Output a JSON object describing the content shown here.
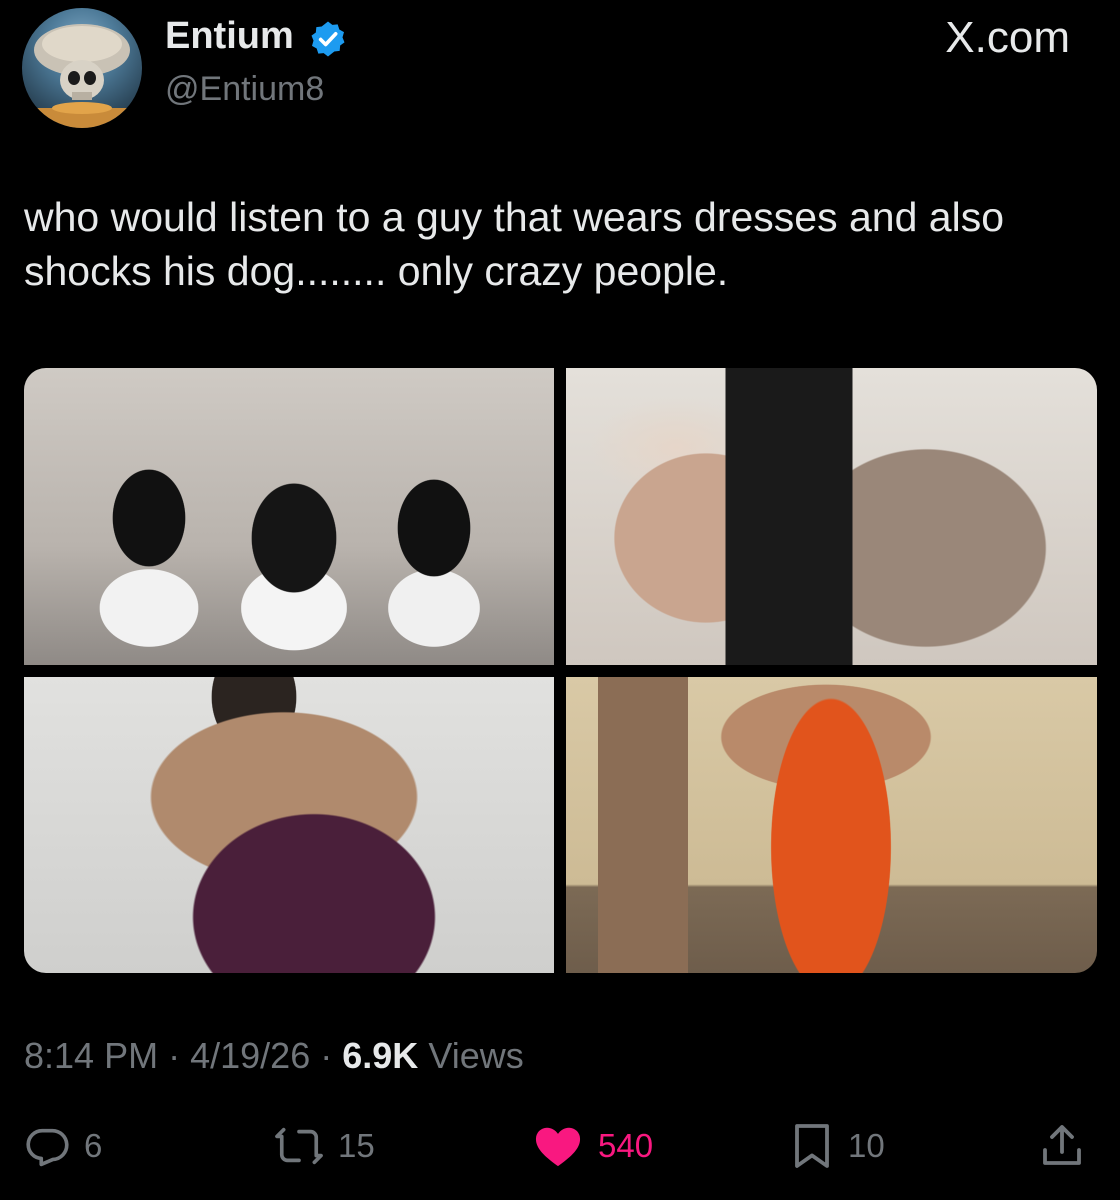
{
  "header": {
    "display_name": "Entium",
    "handle": "@Entium8",
    "source": "X.com",
    "verified": true,
    "avatar_icon": "avatar-image",
    "verified_icon": "verified-badge-icon",
    "accent_color": "#1d9bf0"
  },
  "tweet": {
    "text": "who would listen to a guy that wears dresses and also shocks his dog........ only crazy people."
  },
  "media": {
    "count": 4,
    "items": [
      "photo-1",
      "photo-2",
      "photo-3",
      "photo-4"
    ]
  },
  "meta": {
    "time": "8:14 PM",
    "separator": "·",
    "date": "4/19/26",
    "views_count": "6.9K",
    "views_label": "Views"
  },
  "actions": {
    "reply": {
      "icon": "reply-icon",
      "count": "6"
    },
    "repost": {
      "icon": "repost-icon",
      "count": "15"
    },
    "like": {
      "icon": "heart-icon",
      "count": "540",
      "color": "#f91880",
      "active": true
    },
    "bookmark": {
      "icon": "bookmark-icon",
      "count": "10"
    },
    "share": {
      "icon": "share-icon"
    }
  }
}
